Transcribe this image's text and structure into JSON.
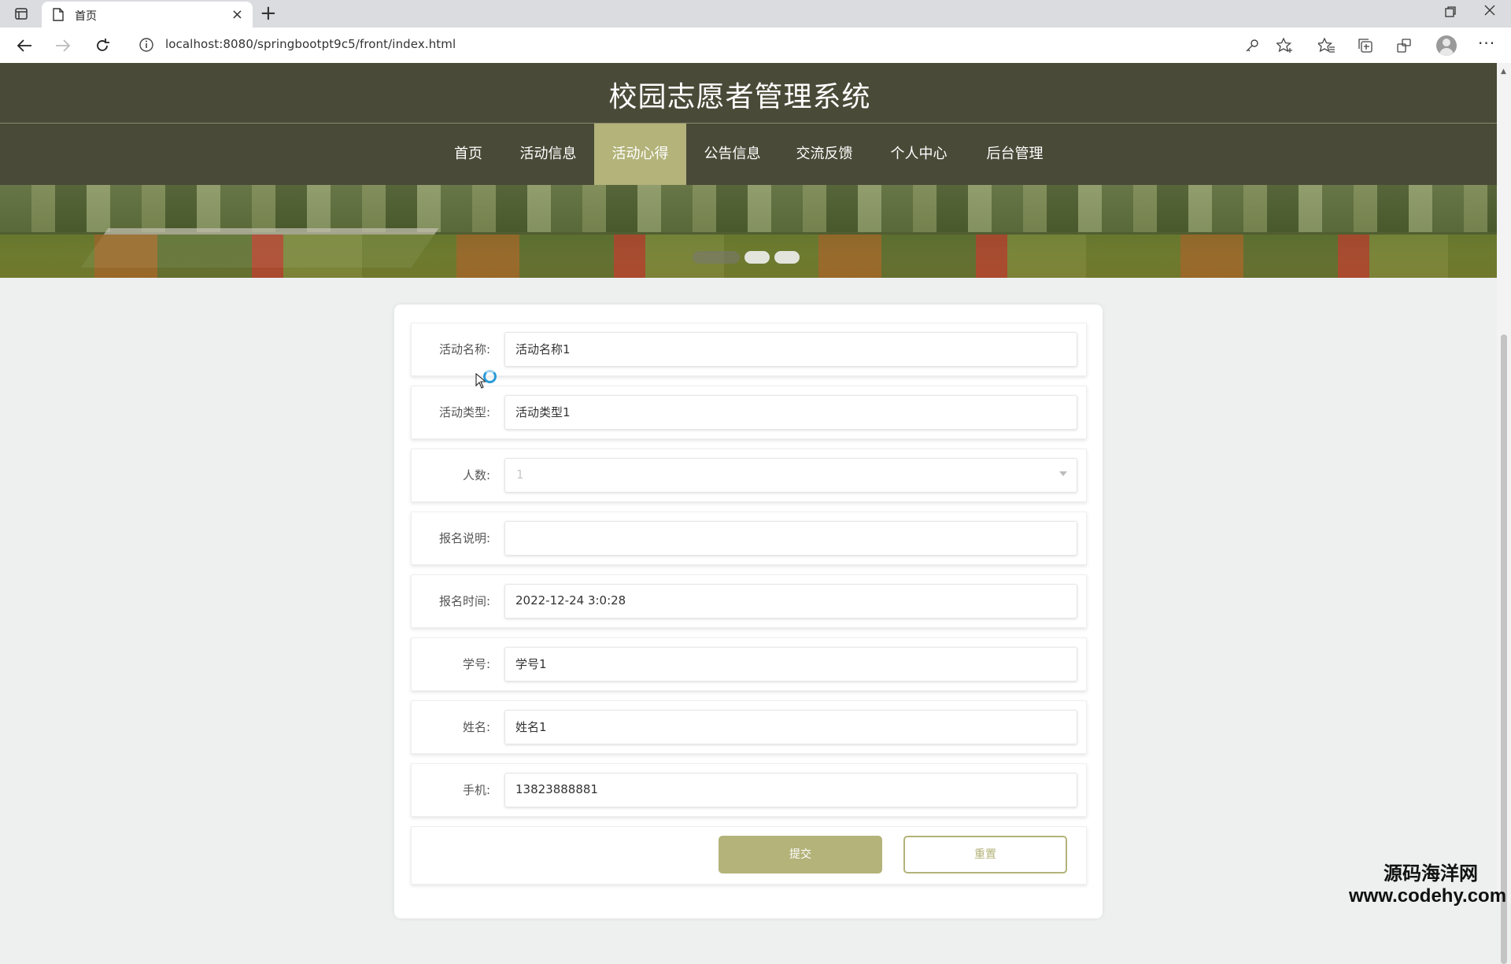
{
  "browser": {
    "tab_title": "首页",
    "tab_close": "×",
    "new_tab": "+",
    "url": "localhost:8080/springbootpt9c5/front/index.html"
  },
  "site": {
    "title": "校园志愿者管理系统",
    "nav": [
      {
        "label": "首页",
        "active": false
      },
      {
        "label": "活动信息",
        "active": false
      },
      {
        "label": "活动心得",
        "active": true
      },
      {
        "label": "公告信息",
        "active": false
      },
      {
        "label": "交流反馈",
        "active": false
      },
      {
        "label": "个人中心",
        "active": false
      },
      {
        "label": "后台管理",
        "active": false
      }
    ]
  },
  "form": {
    "fields": [
      {
        "label": "活动名称:",
        "value": "活动名称1"
      },
      {
        "label": "活动类型:",
        "value": "活动类型1"
      },
      {
        "label": "人数:",
        "value": "1"
      },
      {
        "label": "报名说明:",
        "value": ""
      },
      {
        "label": "报名时间:",
        "value": "2022-12-24 3:0:28"
      },
      {
        "label": "学号:",
        "value": "学号1"
      },
      {
        "label": "姓名:",
        "value": "姓名1"
      },
      {
        "label": "手机:",
        "value": "13823888881"
      }
    ],
    "submit_label": "提交",
    "reset_label": "重置"
  },
  "watermark": {
    "line1": "源码海洋网",
    "line2": "www.codehy.com"
  },
  "colors": {
    "header_bg": "#4a4a38",
    "accent": "#b3b37a"
  }
}
